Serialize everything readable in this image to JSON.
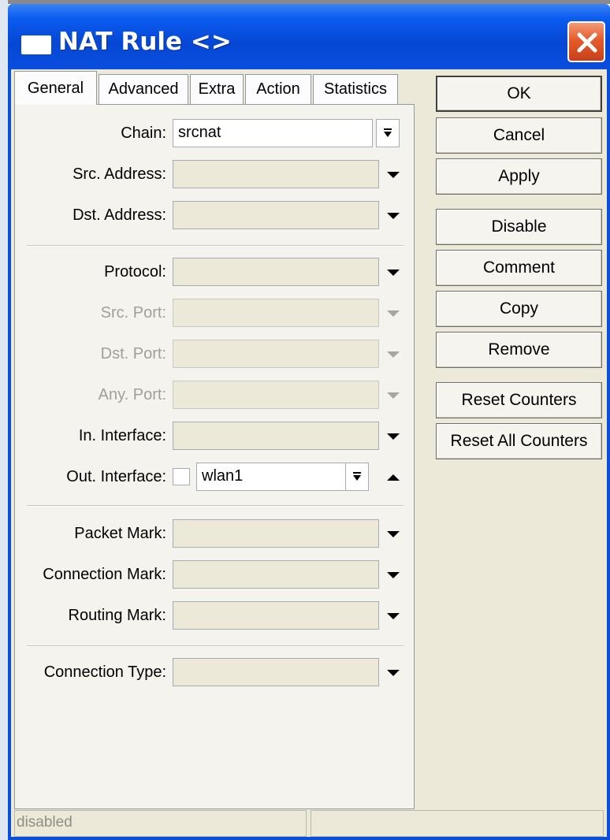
{
  "window": {
    "title": "NAT Rule <>",
    "title_icon": "window-icon",
    "close_icon": "close-icon",
    "close_color": "#e45b2b",
    "titlebar_color": "#0647d4"
  },
  "tabs": [
    {
      "label": "General",
      "active": true
    },
    {
      "label": "Advanced",
      "active": false
    },
    {
      "label": "Extra",
      "active": false
    },
    {
      "label": "Action",
      "active": false
    },
    {
      "label": "Statistics",
      "active": false
    }
  ],
  "form": {
    "chain": {
      "label": "Chain:",
      "value": "srcnat"
    },
    "src_address": {
      "label": "Src. Address:",
      "value": ""
    },
    "dst_address": {
      "label": "Dst. Address:",
      "value": ""
    },
    "protocol": {
      "label": "Protocol:",
      "value": ""
    },
    "src_port": {
      "label": "Src. Port:",
      "value": "",
      "disabled": true
    },
    "dst_port": {
      "label": "Dst. Port:",
      "value": "",
      "disabled": true
    },
    "any_port": {
      "label": "Any. Port:",
      "value": "",
      "disabled": true
    },
    "in_interface": {
      "label": "In. Interface:",
      "value": ""
    },
    "out_interface": {
      "label": "Out. Interface:",
      "value": "wlan1",
      "negate_checked": false
    },
    "packet_mark": {
      "label": "Packet Mark:",
      "value": ""
    },
    "connection_mark": {
      "label": "Connection Mark:",
      "value": ""
    },
    "routing_mark": {
      "label": "Routing Mark:",
      "value": ""
    },
    "connection_type": {
      "label": "Connection Type:",
      "value": ""
    }
  },
  "buttons": {
    "ok": "OK",
    "cancel": "Cancel",
    "apply": "Apply",
    "disable": "Disable",
    "comment": "Comment",
    "copy": "Copy",
    "remove": "Remove",
    "reset_counters": "Reset Counters",
    "reset_all_counters": "Reset All Counters"
  },
  "status": {
    "left": "disabled",
    "right": ""
  }
}
